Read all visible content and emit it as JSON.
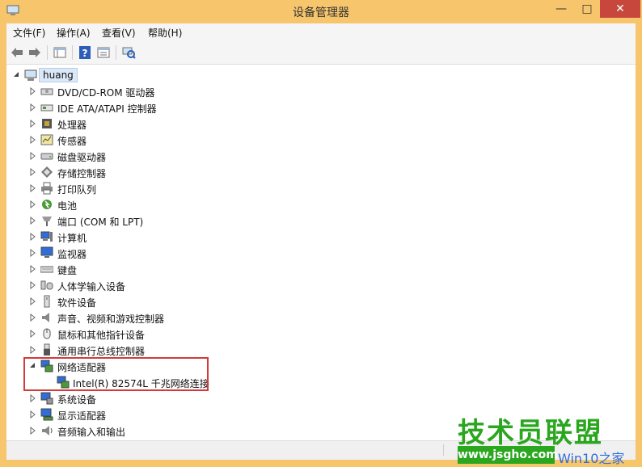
{
  "window": {
    "title": "设备管理器",
    "controls": {
      "minimize": "—",
      "maximize": "□",
      "close": "✕"
    }
  },
  "menubar": {
    "items": [
      "文件(F)",
      "操作(A)",
      "查看(V)",
      "帮助(H)"
    ]
  },
  "toolbar": {
    "buttons": [
      "back-icon",
      "forward-icon",
      "console-tree-icon",
      "help-icon",
      "properties-icon",
      "scan-hardware-icon"
    ]
  },
  "tree": {
    "root": "huang",
    "categories": [
      "DVD/CD-ROM 驱动器",
      "IDE ATA/ATAPI 控制器",
      "处理器",
      "传感器",
      "磁盘驱动器",
      "存储控制器",
      "打印队列",
      "电池",
      "端口 (COM 和 LPT)",
      "计算机",
      "监视器",
      "键盘",
      "人体学输入设备",
      "软件设备",
      "声音、视频和游戏控制器",
      "鼠标和其他指针设备",
      "通用串行总线控制器",
      "网络适配器",
      "系统设备",
      "显示适配器",
      "音频输入和输出"
    ],
    "expanded_category": "网络适配器",
    "expanded_child": "Intel(R) 82574L 千兆网络连接"
  },
  "watermark": {
    "title": "技术员联盟",
    "url": "www.jsgho.com",
    "suffix": "Win10之家"
  },
  "colors": {
    "title_bar": "#f7c56b",
    "close_button": "#c7473d",
    "highlight_border": "#d33a3a",
    "watermark_green": "#2aa61f"
  }
}
